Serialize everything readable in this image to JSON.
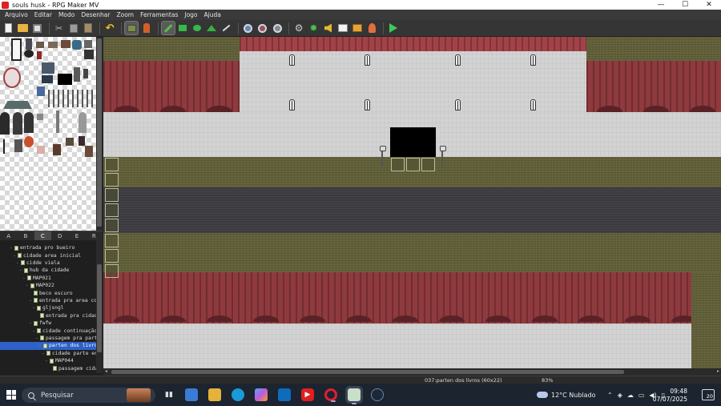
{
  "window": {
    "title": "souls husk - RPG Maker MV",
    "minimize": "—",
    "maximize": "☐",
    "close": "✕"
  },
  "menu": [
    "Arquivo",
    "Editar",
    "Modo",
    "Desenhar",
    "Zoom",
    "Ferramentas",
    "Jogo",
    "Ajuda"
  ],
  "toolbar": {
    "icons": [
      "new-project-icon",
      "open-project-icon",
      "save-project-icon",
      "cut-icon",
      "copy-icon",
      "paste-icon",
      "undo-icon",
      "map-mode-icon",
      "event-mode-icon",
      "pencil-icon",
      "rectangle-icon",
      "ellipse-icon",
      "fill-icon",
      "shadow-pen-icon",
      "zoom-in-icon",
      "zoom-out-icon",
      "actual-size-icon",
      "database-icon",
      "plugin-manager-icon",
      "sound-test-icon",
      "event-searcher-icon",
      "resource-manager-icon",
      "character-generator-icon",
      "playtest-icon"
    ]
  },
  "tileset_tabs": [
    "A",
    "B",
    "C",
    "D",
    "E",
    "R"
  ],
  "active_tab": "C",
  "map_tree": [
    {
      "label": "entrada pro bueiro",
      "depth": 1,
      "expanded": true
    },
    {
      "label": "cidade area inicial",
      "depth": 2,
      "expanded": true
    },
    {
      "label": "cidde viela",
      "depth": 3,
      "expanded": true
    },
    {
      "label": "hub da cidade",
      "depth": 4,
      "expanded": true
    },
    {
      "label": "MAP021",
      "depth": 5,
      "expanded": true
    },
    {
      "label": "MAP022",
      "depth": 6,
      "expanded": true
    },
    {
      "label": "beco escuro",
      "depth": 7,
      "expanded": false
    },
    {
      "label": "entrada pra area comercial",
      "depth": 7,
      "expanded": true
    },
    {
      "label": "gljsngl",
      "depth": 8,
      "expanded": true
    },
    {
      "label": "entrada pra cidade",
      "depth": 9,
      "expanded": false
    },
    {
      "label": "fwfw",
      "depth": 7,
      "expanded": true
    },
    {
      "label": "cidade continuação m",
      "depth": 8,
      "expanded": true
    },
    {
      "label": "passagem pra parte",
      "depth": 9,
      "expanded": true
    },
    {
      "label": "parten dos livros",
      "depth": 10,
      "expanded": true,
      "selected": true
    },
    {
      "label": "cidade parte entr",
      "depth": 11,
      "expanded": true
    },
    {
      "label": "MAP044",
      "depth": 12,
      "expanded": true
    },
    {
      "label": "passagem cidade",
      "depth": 13,
      "expanded": false
    }
  ],
  "status": {
    "map_info": "037:parten dos livros (60x22)",
    "zoom": "83%"
  },
  "taskbar": {
    "search_placeholder": "Pesquisar",
    "weather": "12°C  Nublado",
    "time": "09:48",
    "date": "07/07/2025",
    "notifications": "20",
    "apps": [
      "task-view-icon",
      "store-icon",
      "file-explorer-icon",
      "edge-icon",
      "copilot-icon",
      "outlook-icon",
      "youtube-icon",
      "opera-icon",
      "rpg-maker-icon",
      "steam-icon"
    ]
  },
  "colors": {
    "roof": "#8f3a3e",
    "wall": "#d3d3d3",
    "grass": "#62613a",
    "road": "#3a3a3f",
    "selection": "#2f61c8"
  }
}
